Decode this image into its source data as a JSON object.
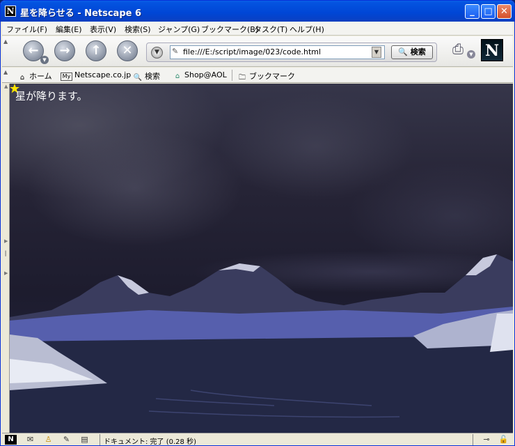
{
  "window": {
    "title": "星を降らせる - Netscape 6",
    "app_icon_letter": "N"
  },
  "menubar": {
    "items": [
      "ファイル(F)",
      "編集(E)",
      "表示(V)",
      "検索(S)",
      "ジャンプ(G)",
      "ブックマーク(B)",
      "タスク(T)",
      "ヘルプ(H)"
    ]
  },
  "navigation": {
    "url": "file:///E:/script/image/023/code.html",
    "search_label": "検索",
    "logo_letter": "N"
  },
  "personal_toolbar": {
    "items": [
      "ホーム",
      "Netscape.co.jp",
      "検索",
      "Shop@AOL",
      "ブックマーク"
    ],
    "icon_my": "My"
  },
  "content": {
    "text": "星が降ります。"
  },
  "status": {
    "text": "ドキュメント: 完了 (0.28 秒)"
  },
  "icons": [
    "back-icon",
    "forward-icon",
    "reload-icon",
    "stop-icon",
    "print-icon",
    "netscape-logo",
    "home-icon",
    "search-icon",
    "shop-icon",
    "bookmark-folder-icon",
    "star-icon",
    "mail-icon",
    "instant-messenger-icon",
    "composer-icon",
    "address-book-icon",
    "connection-icon",
    "security-lock-icon"
  ],
  "colors": {
    "titlebar": "#0046d5",
    "content_sky": "#262436",
    "star": "#ffe600",
    "text_on_image": "#ffffff"
  }
}
